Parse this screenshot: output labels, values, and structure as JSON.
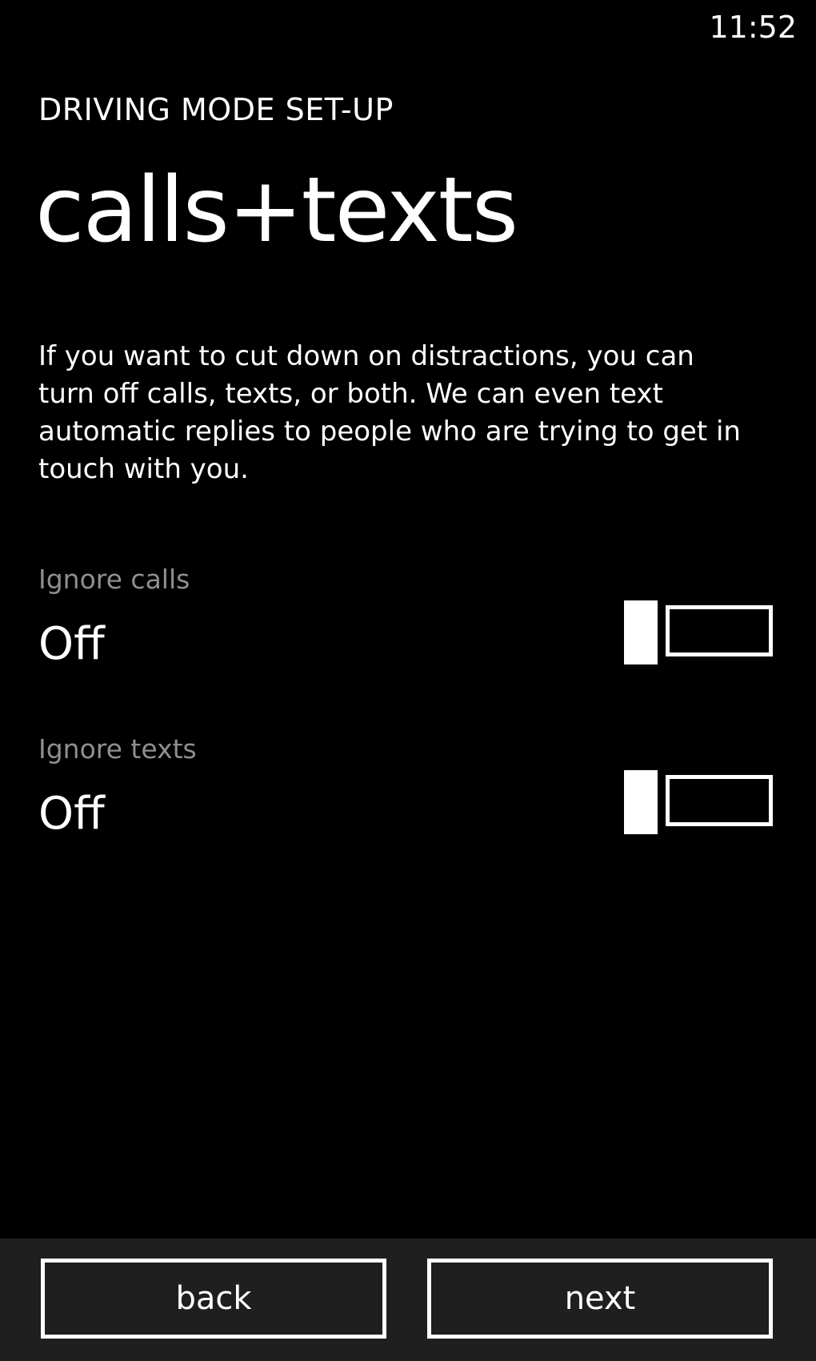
{
  "status_bar": {
    "time": "11:52"
  },
  "header": {
    "app_title": "DRIVING MODE SET-UP",
    "page_title": "calls+texts"
  },
  "main": {
    "description": "If you want to cut down on distractions, you can turn off calls, texts, or both. We can even text automatic replies to people who are trying to get in touch with you.",
    "settings": [
      {
        "label": "Ignore calls",
        "value": "Off",
        "toggled_on": false
      },
      {
        "label": "Ignore texts",
        "value": "Off",
        "toggled_on": false
      }
    ]
  },
  "app_bar": {
    "back_label": "back",
    "next_label": "next"
  },
  "colors": {
    "background": "#000000",
    "foreground": "#ffffff",
    "label_gray": "#8f8f8f",
    "app_bar": "#1f1f1f"
  }
}
